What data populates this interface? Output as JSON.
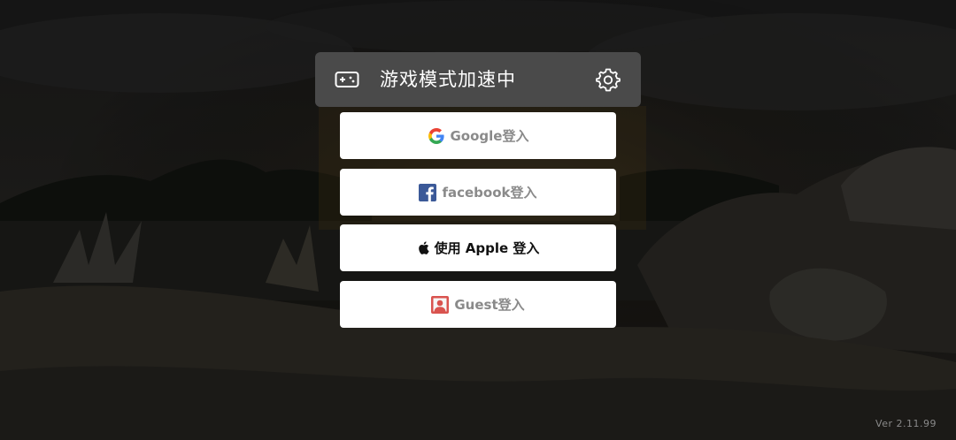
{
  "banner": {
    "title": "游戏模式加速中",
    "left_icon": "gamepad-icon",
    "right_icon": "gear-icon"
  },
  "login_buttons": [
    {
      "label": "Google登入",
      "icon": "google-icon"
    },
    {
      "label": "facebook登入",
      "icon": "facebook-icon"
    },
    {
      "label": "使用 Apple 登入",
      "icon": "apple-icon"
    },
    {
      "label": "Guest登入",
      "icon": "guest-icon"
    }
  ],
  "version": "Ver 2.11.99",
  "colors": {
    "banner_bg": "#4a4a4a",
    "button_bg": "#ffffff",
    "label_gray": "#8a8a8a",
    "label_dark": "#111111",
    "facebook_blue": "#3b5998",
    "guest_red": "#d9534f"
  }
}
